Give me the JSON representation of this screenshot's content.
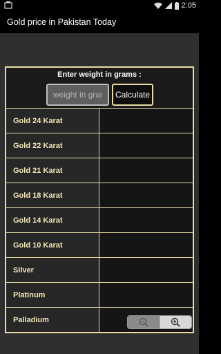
{
  "status_bar": {
    "time": "2:05",
    "icons": [
      "wifi-icon",
      "signal-icon",
      "battery-icon"
    ]
  },
  "app_bar": {
    "title": "Gold price in Pakistan Today"
  },
  "calculator": {
    "prompt": "Enter weight in grams :",
    "input_placeholder": "weight in grams",
    "input_value": "",
    "button_label": "Calculate"
  },
  "rows": [
    {
      "label": "Gold 24 Karat",
      "value": ""
    },
    {
      "label": "Gold 22 Karat",
      "value": ""
    },
    {
      "label": "Gold 21 Karat",
      "value": ""
    },
    {
      "label": "Gold 18 Karat",
      "value": ""
    },
    {
      "label": "Gold 14 Karat",
      "value": ""
    },
    {
      "label": "Gold 10 Karat",
      "value": ""
    },
    {
      "label": "Silver",
      "value": ""
    },
    {
      "label": "Platinum",
      "value": ""
    },
    {
      "label": "Palladium",
      "value": ""
    }
  ],
  "zoom_controls": {
    "icons": [
      "zoom-out-icon",
      "zoom-in-icon"
    ]
  },
  "colors": {
    "accent_border": "#e9dca8",
    "label_text": "#f1e6b6",
    "background": "#2f2f2f"
  }
}
